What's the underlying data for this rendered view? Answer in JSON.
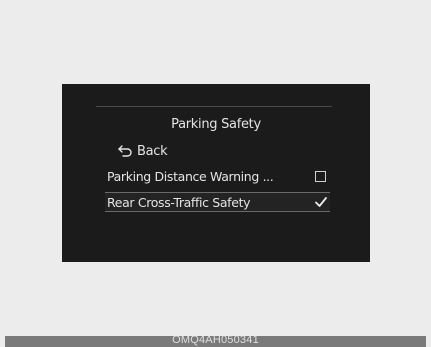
{
  "screen": {
    "title": "Parking Safety",
    "back": {
      "label": "Back",
      "icon": "back-arrow-icon"
    },
    "items": [
      {
        "label": "Parking Distance Warning ...",
        "checked": false,
        "selected": false
      },
      {
        "label": "Rear Cross-Traffic Safety",
        "checked": true,
        "selected": true
      }
    ]
  },
  "footer": {
    "code": "OMQ4AH050341"
  },
  "colors": {
    "background": "#ececec",
    "screen": "#1b1b1b",
    "text": "#e4e4e4",
    "footer_bar": "#7a7a7a"
  }
}
